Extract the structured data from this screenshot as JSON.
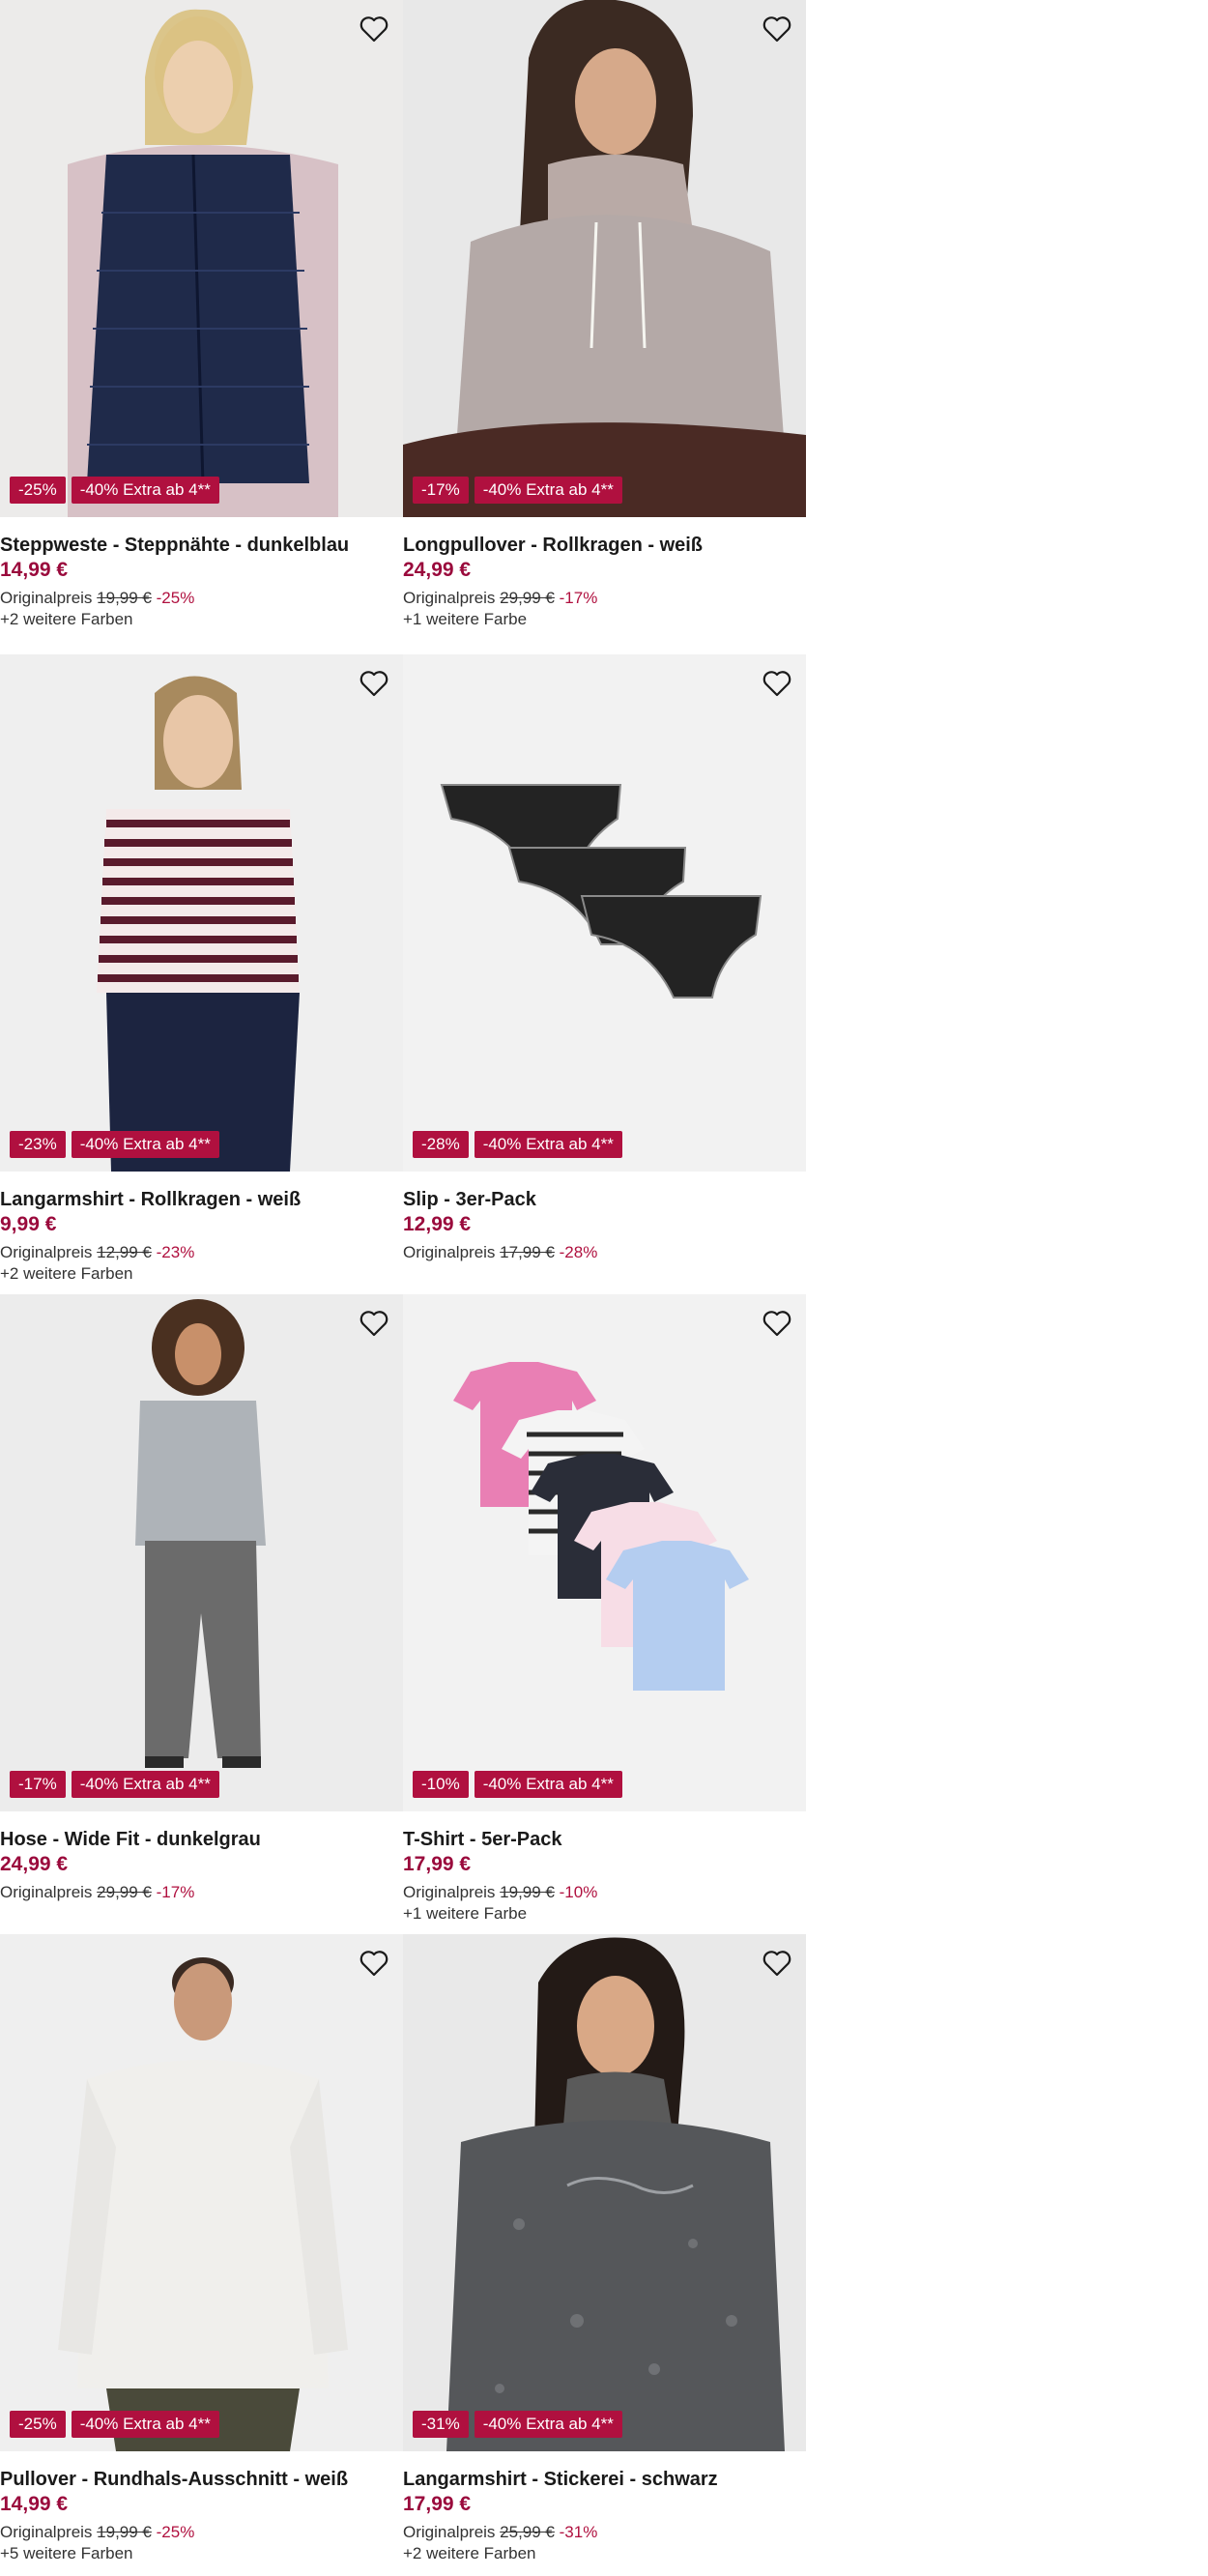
{
  "colors": {
    "badge": "#b0103f",
    "price": "#9a0a3c",
    "image_bg": "#f2f2f2"
  },
  "icons": {
    "wishlist": "heart-outline-icon"
  },
  "products": [
    {
      "name": "Steppweste - Steppnähte - dunkelblau",
      "price": "14,99 €",
      "badge_discount": "-25%",
      "badge_extra": "-40% Extra ab 4**",
      "orig_label": "Originalpreis",
      "orig_price": "19,99 €",
      "orig_pct": "-25%",
      "more_colors": "+2 weitere Farben"
    },
    {
      "name": "Longpullover - Rollkragen - weiß",
      "price": "24,99 €",
      "badge_discount": "-17%",
      "badge_extra": "-40% Extra ab 4**",
      "orig_label": "Originalpreis",
      "orig_price": "29,99 €",
      "orig_pct": "-17%",
      "more_colors": "+1 weitere Farbe"
    },
    {
      "name": "Langarmshirt - Rollkragen - weiß",
      "price": "9,99 €",
      "badge_discount": "-23%",
      "badge_extra": "-40% Extra ab 4**",
      "orig_label": "Originalpreis",
      "orig_price": "12,99 €",
      "orig_pct": "-23%",
      "more_colors": "+2 weitere Farben"
    },
    {
      "name": "Slip - 3er-Pack",
      "price": "12,99 €",
      "badge_discount": "-28%",
      "badge_extra": "-40% Extra ab 4**",
      "orig_label": "Originalpreis",
      "orig_price": "17,99 €",
      "orig_pct": "-28%",
      "more_colors": ""
    },
    {
      "name": "Hose - Wide Fit - dunkelgrau",
      "price": "24,99 €",
      "badge_discount": "-17%",
      "badge_extra": "-40% Extra ab 4**",
      "orig_label": "Originalpreis",
      "orig_price": "29,99 €",
      "orig_pct": "-17%",
      "more_colors": ""
    },
    {
      "name": "T-Shirt - 5er-Pack",
      "price": "17,99 €",
      "badge_discount": "-10%",
      "badge_extra": "-40% Extra ab 4**",
      "orig_label": "Originalpreis",
      "orig_price": "19,99 €",
      "orig_pct": "-10%",
      "more_colors": "+1 weitere Farbe"
    },
    {
      "name": "Pullover - Rundhals-Ausschnitt - weiß",
      "price": "14,99 €",
      "badge_discount": "-25%",
      "badge_extra": "-40% Extra ab 4**",
      "orig_label": "Originalpreis",
      "orig_price": "19,99 €",
      "orig_pct": "-25%",
      "more_colors": "+5 weitere Farben"
    },
    {
      "name": "Langarmshirt - Stickerei - schwarz",
      "price": "17,99 €",
      "badge_discount": "-31%",
      "badge_extra": "-40% Extra ab 4**",
      "orig_label": "Originalpreis",
      "orig_price": "25,99 €",
      "orig_pct": "-31%",
      "more_colors": "+2 weitere Farben"
    }
  ]
}
